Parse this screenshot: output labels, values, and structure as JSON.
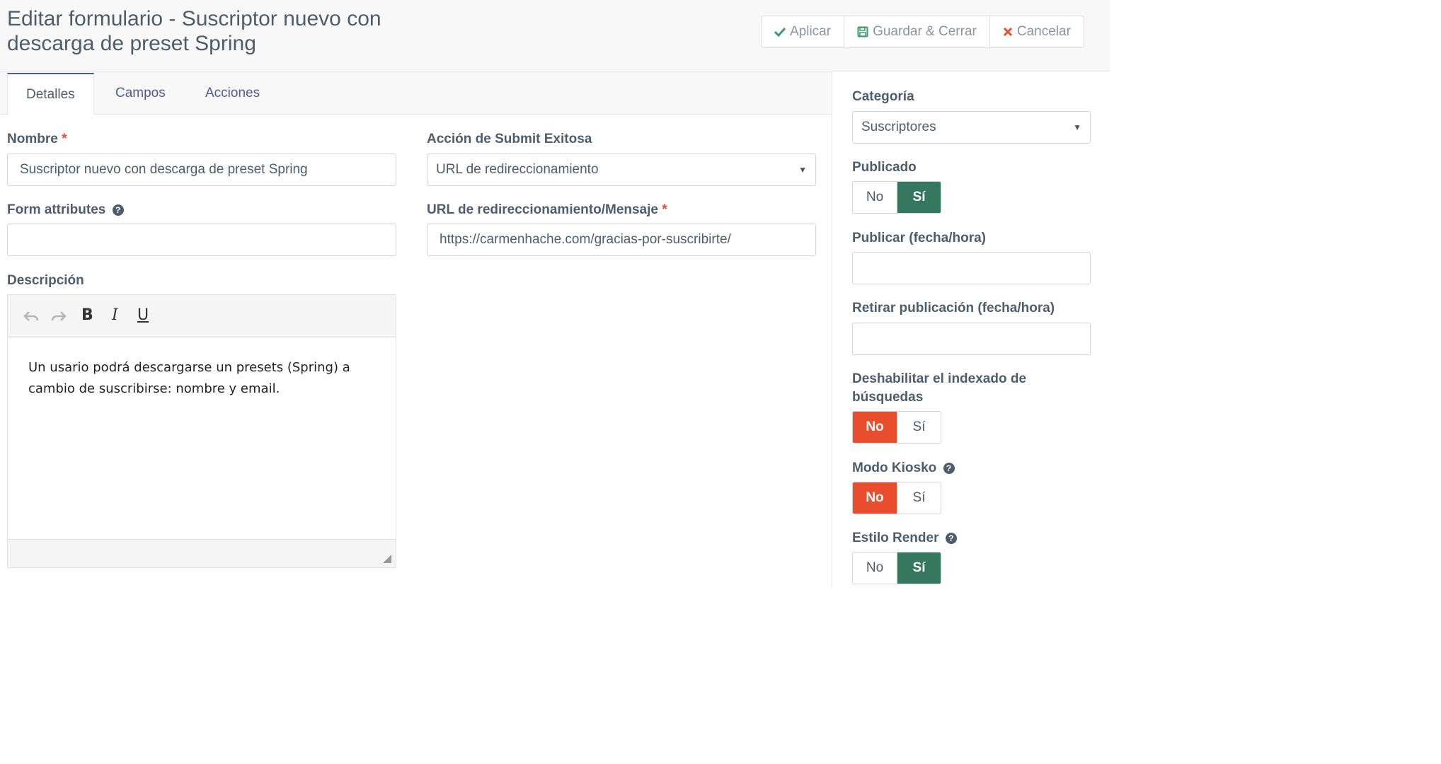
{
  "header": {
    "title": "Editar formulario - Suscriptor nuevo con descarga de preset Spring",
    "buttons": {
      "apply": "Aplicar",
      "save_close": "Guardar & Cerrar",
      "cancel": "Cancelar"
    }
  },
  "tabs": [
    {
      "label": "Detalles"
    },
    {
      "label": "Campos"
    },
    {
      "label": "Acciones"
    }
  ],
  "form": {
    "name_label": "Nombre",
    "name_value": "Suscriptor nuevo con descarga de preset Spring",
    "attributes_label": "Form attributes",
    "attributes_value": "",
    "description_label": "Descripción",
    "description_text": "Un usario podrá descargarse un presets (Spring) a cambio de suscribirse: nombre y email.",
    "submit_action_label": "Acción de Submit Exitosa",
    "submit_action_value": "URL de redireccionamiento",
    "redirect_label": "URL de redireccionamiento/Mensaje",
    "redirect_value": "https://carmenhache.com/gracias-por-suscribirte/",
    "required_mark": "*"
  },
  "editor": {
    "bold": "B",
    "italic": "I",
    "underline": "U"
  },
  "sidebar": {
    "category_label": "Categoría",
    "category_value": "Suscriptores",
    "published_label": "Publicado",
    "publish_up_label": "Publicar (fecha/hora)",
    "publish_up_value": "",
    "publish_down_label": "Retirar publicación (fecha/hora)",
    "publish_down_value": "",
    "no_index_label": "Deshabilitar el indexado de búsquedas",
    "kiosk_label": "Modo Kiosko",
    "render_style_label": "Estilo Render",
    "no": "No",
    "yes": "Sí",
    "published_selected": "Sí",
    "no_index_selected": "No",
    "kiosk_selected": "No",
    "render_style_selected": "Sí"
  },
  "colors": {
    "accent_green": "#35775f",
    "accent_red": "#e84e2e",
    "tab_active": "#4e5d8c"
  }
}
